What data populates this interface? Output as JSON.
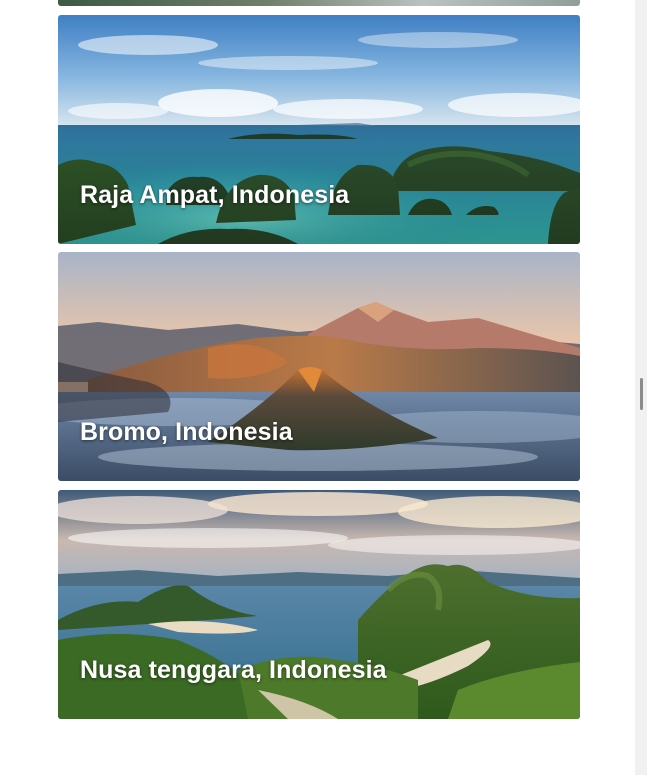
{
  "cards": [
    {
      "label": "Raja Ampat, Indonesia"
    },
    {
      "label": "Bromo, Indonesia"
    },
    {
      "label": "Nusa tenggara, Indonesia"
    }
  ],
  "colors": {
    "scrollbar_track": "#f1f1f1",
    "scrollbar_thumb": "#8c8c8c",
    "caption_text": "#ffffff"
  }
}
